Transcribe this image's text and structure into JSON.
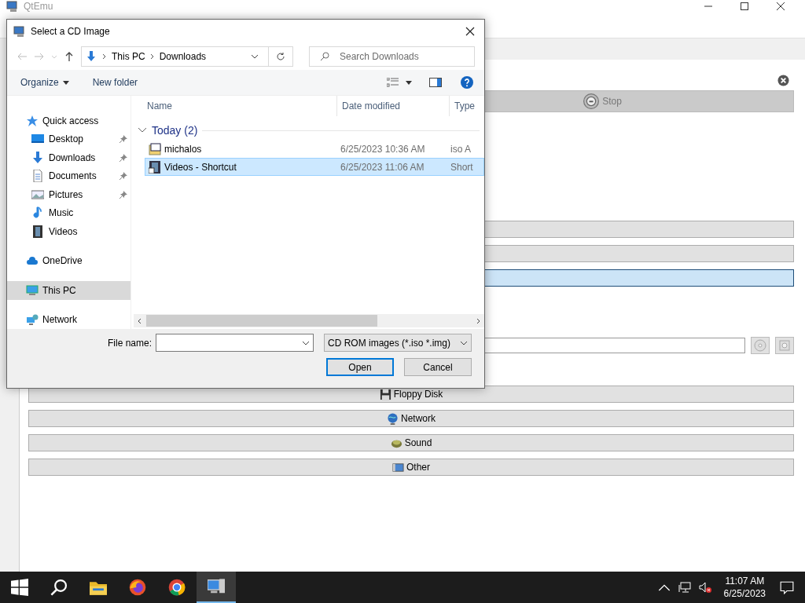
{
  "main_window": {
    "title": "QtEmu",
    "stop_button": "Stop",
    "device_rows": [
      {
        "selected": false
      },
      {
        "selected": false
      },
      {
        "selected": true
      }
    ],
    "sections": [
      {
        "label": "Floppy Disk",
        "kind": "floppy"
      },
      {
        "label": "Network",
        "kind": "globe"
      },
      {
        "label": "Sound",
        "kind": "sound"
      },
      {
        "label": "Other",
        "kind": "other"
      }
    ]
  },
  "dialog": {
    "title": "Select a CD Image",
    "breadcrumb": [
      "This PC",
      "Downloads"
    ],
    "search_placeholder": "Search Downloads",
    "toolbar": [
      "Organize",
      "New folder"
    ],
    "nav": [
      {
        "label": "Quick access",
        "kind": "star",
        "selected": false,
        "children": [
          {
            "label": "Desktop",
            "kind": "desktop",
            "pinned": true,
            "selected": false
          },
          {
            "label": "Downloads",
            "kind": "download",
            "pinned": true,
            "selected": false
          },
          {
            "label": "Documents",
            "kind": "document",
            "pinned": true,
            "selected": false
          },
          {
            "label": "Pictures",
            "kind": "picture",
            "pinned": true,
            "selected": false
          },
          {
            "label": "Music",
            "kind": "music",
            "pinned": false,
            "selected": false
          },
          {
            "label": "Videos",
            "kind": "video",
            "pinned": false,
            "selected": false
          }
        ]
      },
      {
        "label": "OneDrive",
        "kind": "cloud",
        "selected": false
      },
      {
        "label": "This PC",
        "kind": "pc",
        "selected": true
      },
      {
        "label": "Network",
        "kind": "network",
        "selected": false
      }
    ],
    "columns": [
      "Name",
      "Date modified",
      "Type"
    ],
    "group": "Today (2)",
    "files": [
      {
        "name": "michalos",
        "date": "6/25/2023 10:36 AM",
        "type": "iso A",
        "kind": "iso",
        "selected": false
      },
      {
        "name": "Videos - Shortcut",
        "date": "6/25/2023 11:06 AM",
        "type": "Short",
        "kind": "video",
        "selected": true
      }
    ],
    "file_name_label": "File name:",
    "file_type": "CD ROM images (*.iso *.img)",
    "buttons": [
      "Open",
      "Cancel"
    ]
  },
  "taskbar": {
    "apps": [
      {
        "kind": "folder",
        "active": false
      },
      {
        "kind": "fox",
        "active": false
      },
      {
        "kind": "chrome",
        "active": false
      },
      {
        "kind": "emu",
        "active": true
      }
    ],
    "time": "11:07 AM",
    "date": "6/25/2023"
  }
}
